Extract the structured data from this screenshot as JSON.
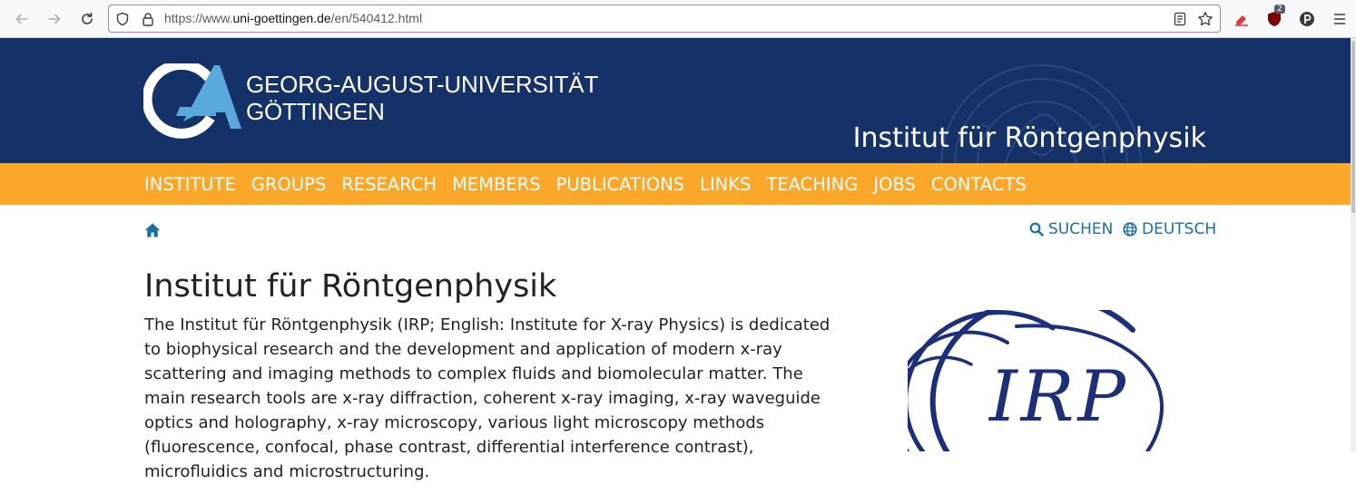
{
  "browser": {
    "url_prefix": "https://www.",
    "url_domain": "uni-goettingen.de",
    "url_path": "/en/540412.html",
    "extension_badge": "2"
  },
  "header": {
    "university_line1": "GEORG-AUGUST-UNIVERSITÄT",
    "university_line2": "GÖTTINGEN",
    "institute_name": "Institut für Röntgenphysik"
  },
  "nav": {
    "items": [
      "INSTITUTE",
      "GROUPS",
      "RESEARCH",
      "MEMBERS",
      "PUBLICATIONS",
      "LINKS",
      "TEACHING",
      "JOBS",
      "CONTACTS"
    ]
  },
  "utility": {
    "search_label": "SUCHEN",
    "language_label": "DEUTSCH"
  },
  "main": {
    "title": "Institut für Röntgenphysik",
    "intro": "The Institut für Röntgenphysik (IRP; English: Institute for X-ray Physics) is dedicated to biophysical research and the development and application of modern x-ray scattering and imaging methods to complex fluids and biomolecular matter. The main research tools are x-ray diffraction, coherent x-ray imaging, x-ray waveguide optics and holography, x-ray microscopy, various light microscopy methods (fluorescence, confocal, phase contrast, differential interference contrast), microfluidics and microstructuring.",
    "logo_text": "IRP"
  },
  "colors": {
    "header_blue": "#153268",
    "nav_orange": "#fba72a",
    "link_blue": "#1b6fa8",
    "logo_blue": "#1d2f7a"
  }
}
